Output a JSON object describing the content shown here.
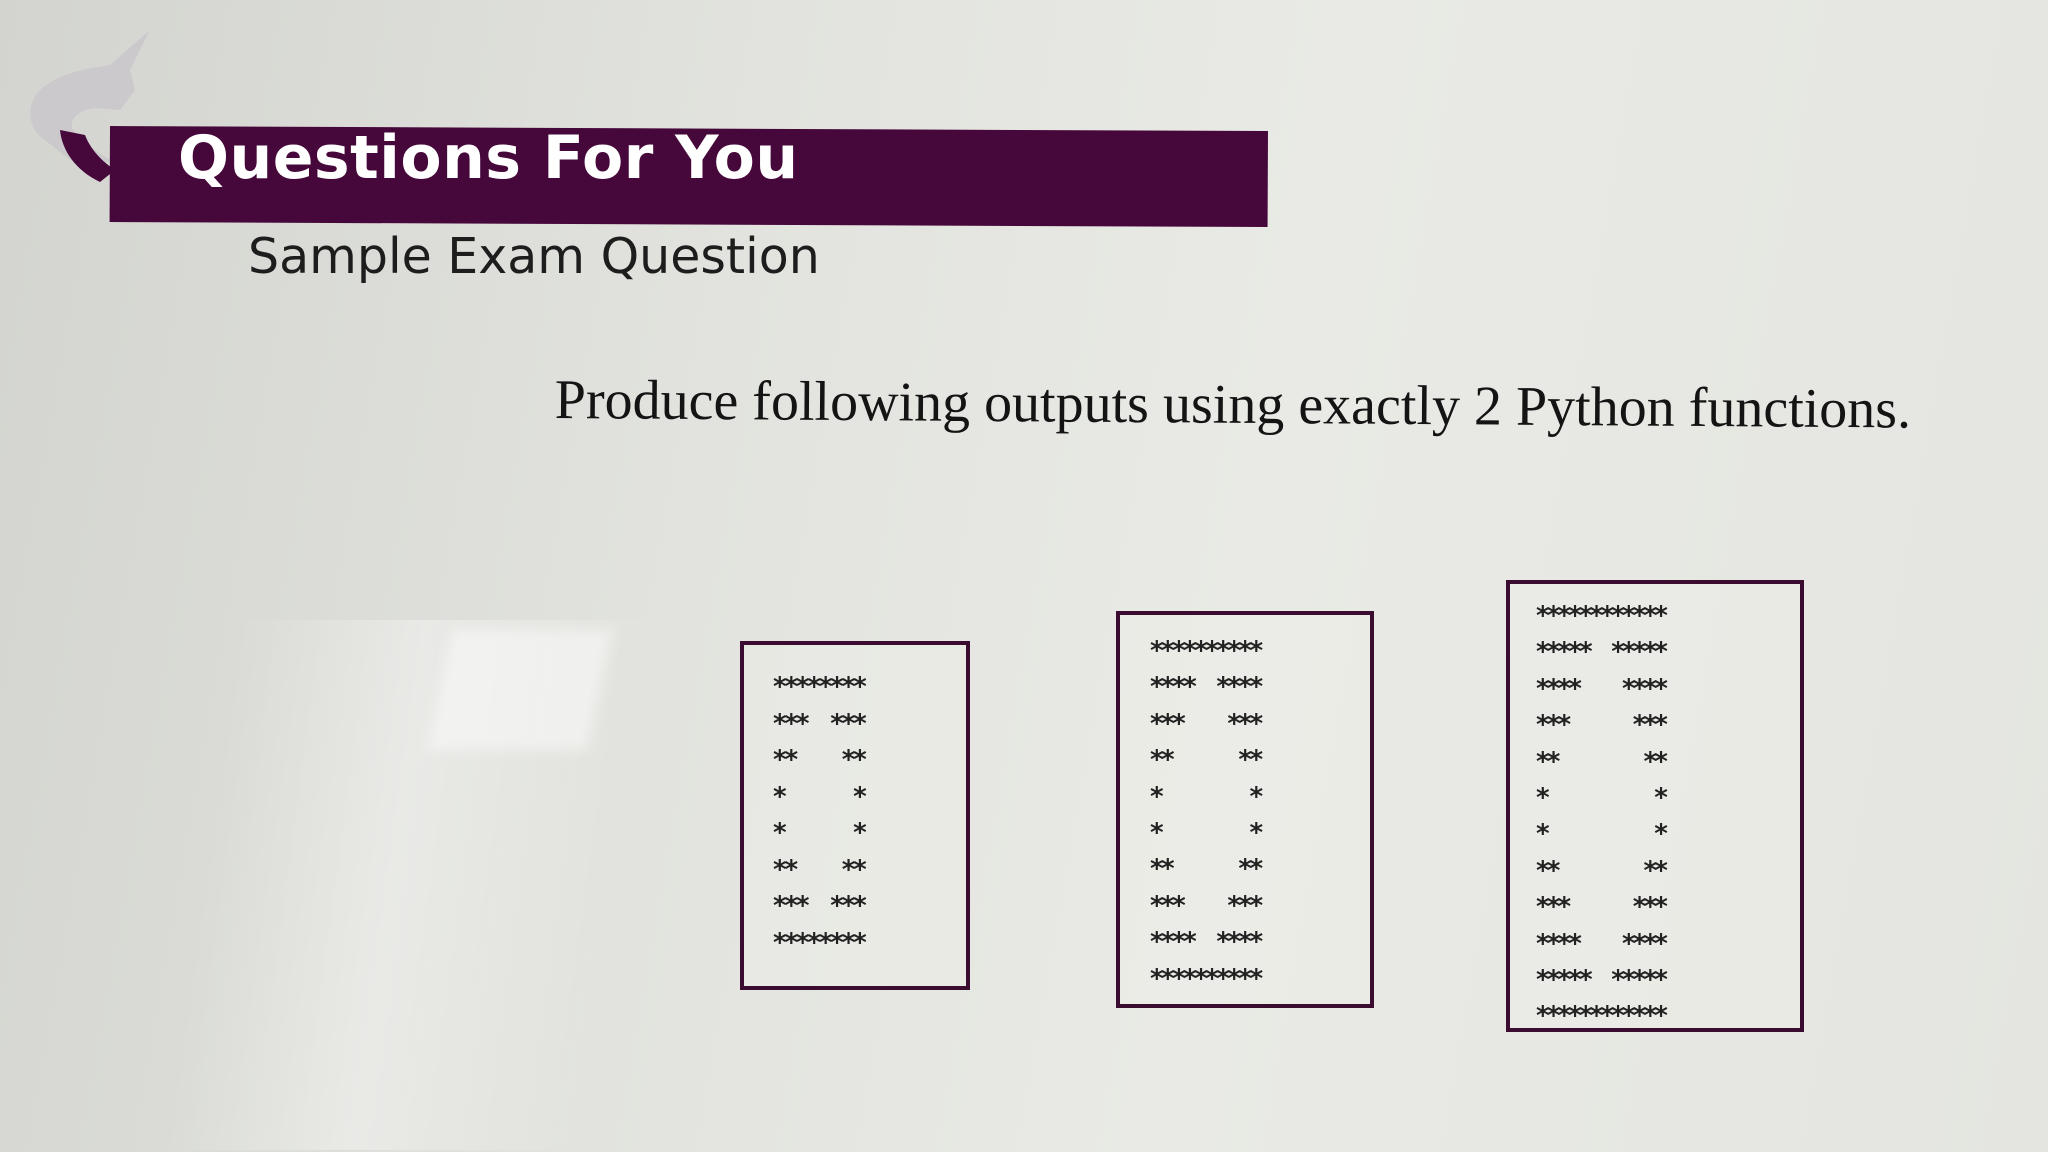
{
  "header": {
    "title": "Questions For You",
    "subtitle": "Sample Exam Question"
  },
  "question": {
    "prompt": "Produce following outputs using exactly 2 Python functions."
  },
  "patterns": [
    {
      "lines": [
        "********",
        "***  ***",
        "**    **",
        "*      *",
        "*      *",
        "**    **",
        "***  ***",
        "********"
      ]
    },
    {
      "lines": [
        "**********",
        "****  ****",
        "***    ***",
        "**      **",
        "*        *",
        "*        *",
        "**      **",
        "***    ***",
        "****  ****",
        "**********"
      ]
    },
    {
      "lines": [
        "************",
        "*****  *****",
        "****    ****",
        "***      ***",
        "**        **",
        "*          *",
        "*          *",
        "**        **",
        "***      ***",
        "****    ****",
        "*****  *****",
        "************"
      ]
    }
  ],
  "colors": {
    "title_bar": "#46073a",
    "box_border": "#3b0b30"
  }
}
